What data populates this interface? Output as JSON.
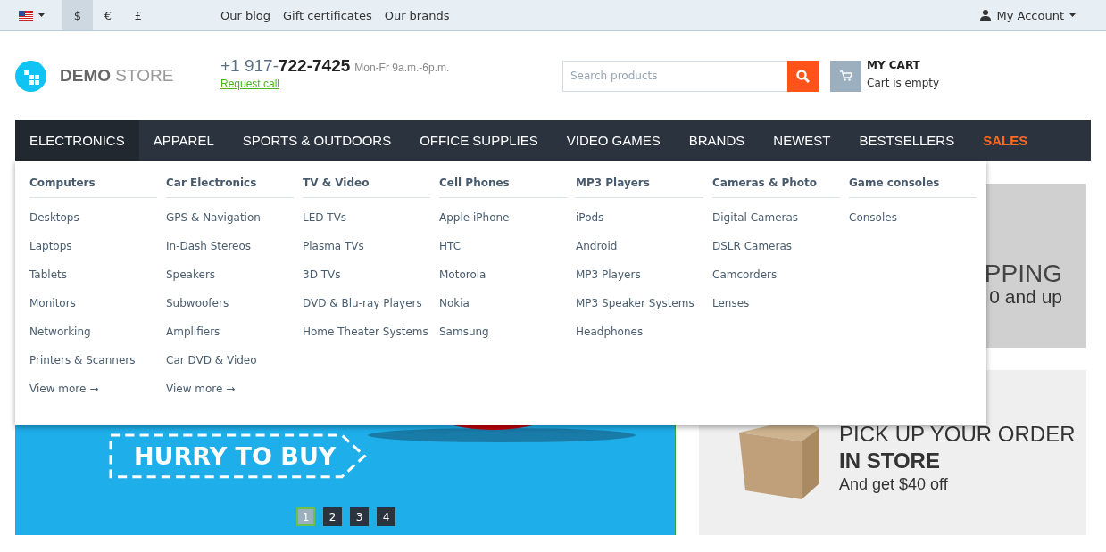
{
  "top_bar": {
    "currencies": [
      {
        "symbol": "$",
        "selected": true
      },
      {
        "symbol": "€",
        "selected": false
      },
      {
        "symbol": "£",
        "selected": false
      }
    ],
    "links": [
      "Our blog",
      "Gift certificates",
      "Our brands"
    ],
    "account": "My Account"
  },
  "header": {
    "logo": {
      "bold": "DEMO",
      "light": "STORE"
    },
    "phone": {
      "prefix": "+1 917-",
      "number": "722-7425",
      "hours": "Mon-Fr 9a.m.-6p.m."
    },
    "request_call": "Request call",
    "search": {
      "placeholder": "Search products"
    },
    "cart": {
      "title": "MY CART",
      "status": "Cart is empty"
    }
  },
  "nav": [
    {
      "label": "ELECTRONICS",
      "selected": true,
      "kind": "normal"
    },
    {
      "label": "APPAREL",
      "selected": false,
      "kind": "normal"
    },
    {
      "label": "SPORTS & OUTDOORS",
      "selected": false,
      "kind": "normal"
    },
    {
      "label": "OFFICE SUPPLIES",
      "selected": false,
      "kind": "normal"
    },
    {
      "label": "VIDEO GAMES",
      "selected": false,
      "kind": "normal"
    },
    {
      "label": "BRANDS",
      "selected": false,
      "kind": "normal"
    },
    {
      "label": "NEWEST",
      "selected": false,
      "kind": "normal"
    },
    {
      "label": "BESTSELLERS",
      "selected": false,
      "kind": "normal"
    },
    {
      "label": "SALES",
      "selected": false,
      "kind": "sale"
    }
  ],
  "dropdown": [
    {
      "title": "Computers",
      "items": [
        "Desktops",
        "Laptops",
        "Tablets",
        "Monitors",
        "Networking",
        "Printers & Scanners"
      ],
      "more": "View more →"
    },
    {
      "title": "Car Electronics",
      "items": [
        "GPS & Navigation",
        "In-Dash Stereos",
        "Speakers",
        "Subwoofers",
        "Amplifiers",
        "Car DVD & Video"
      ],
      "more": "View more →"
    },
    {
      "title": "TV & Video",
      "items": [
        "LED TVs",
        "Plasma TVs",
        "3D TVs",
        "DVD & Blu-ray Players",
        "Home Theater Systems"
      ]
    },
    {
      "title": "Cell Phones",
      "items": [
        "Apple iPhone",
        "HTC",
        "Motorola",
        "Nokia",
        "Samsung"
      ]
    },
    {
      "title": "MP3 Players",
      "items": [
        "iPods",
        "Android",
        "MP3 Players",
        "MP3 Speaker Systems",
        "Headphones"
      ]
    },
    {
      "title": "Cameras & Photo",
      "items": [
        "Digital Cameras",
        "DSLR Cameras",
        "Camcorders",
        "Lenses"
      ]
    },
    {
      "title": "Game consoles",
      "items": [
        "Consoles"
      ]
    }
  ],
  "main_banner": {
    "button": "HURRY TO BUY",
    "pages": [
      {
        "label": "1",
        "selected": true
      },
      {
        "label": "2",
        "selected": false
      },
      {
        "label": "3",
        "selected": false
      },
      {
        "label": "4",
        "selected": false
      }
    ]
  },
  "side_banners": [
    {
      "kind": "shipping",
      "lines": [
        "PPING",
        "0 and up"
      ]
    },
    {
      "kind": "pickup",
      "lines": [
        "PICK UP YOUR ORDER",
        "IN STORE",
        "And get $40 off"
      ]
    }
  ]
}
